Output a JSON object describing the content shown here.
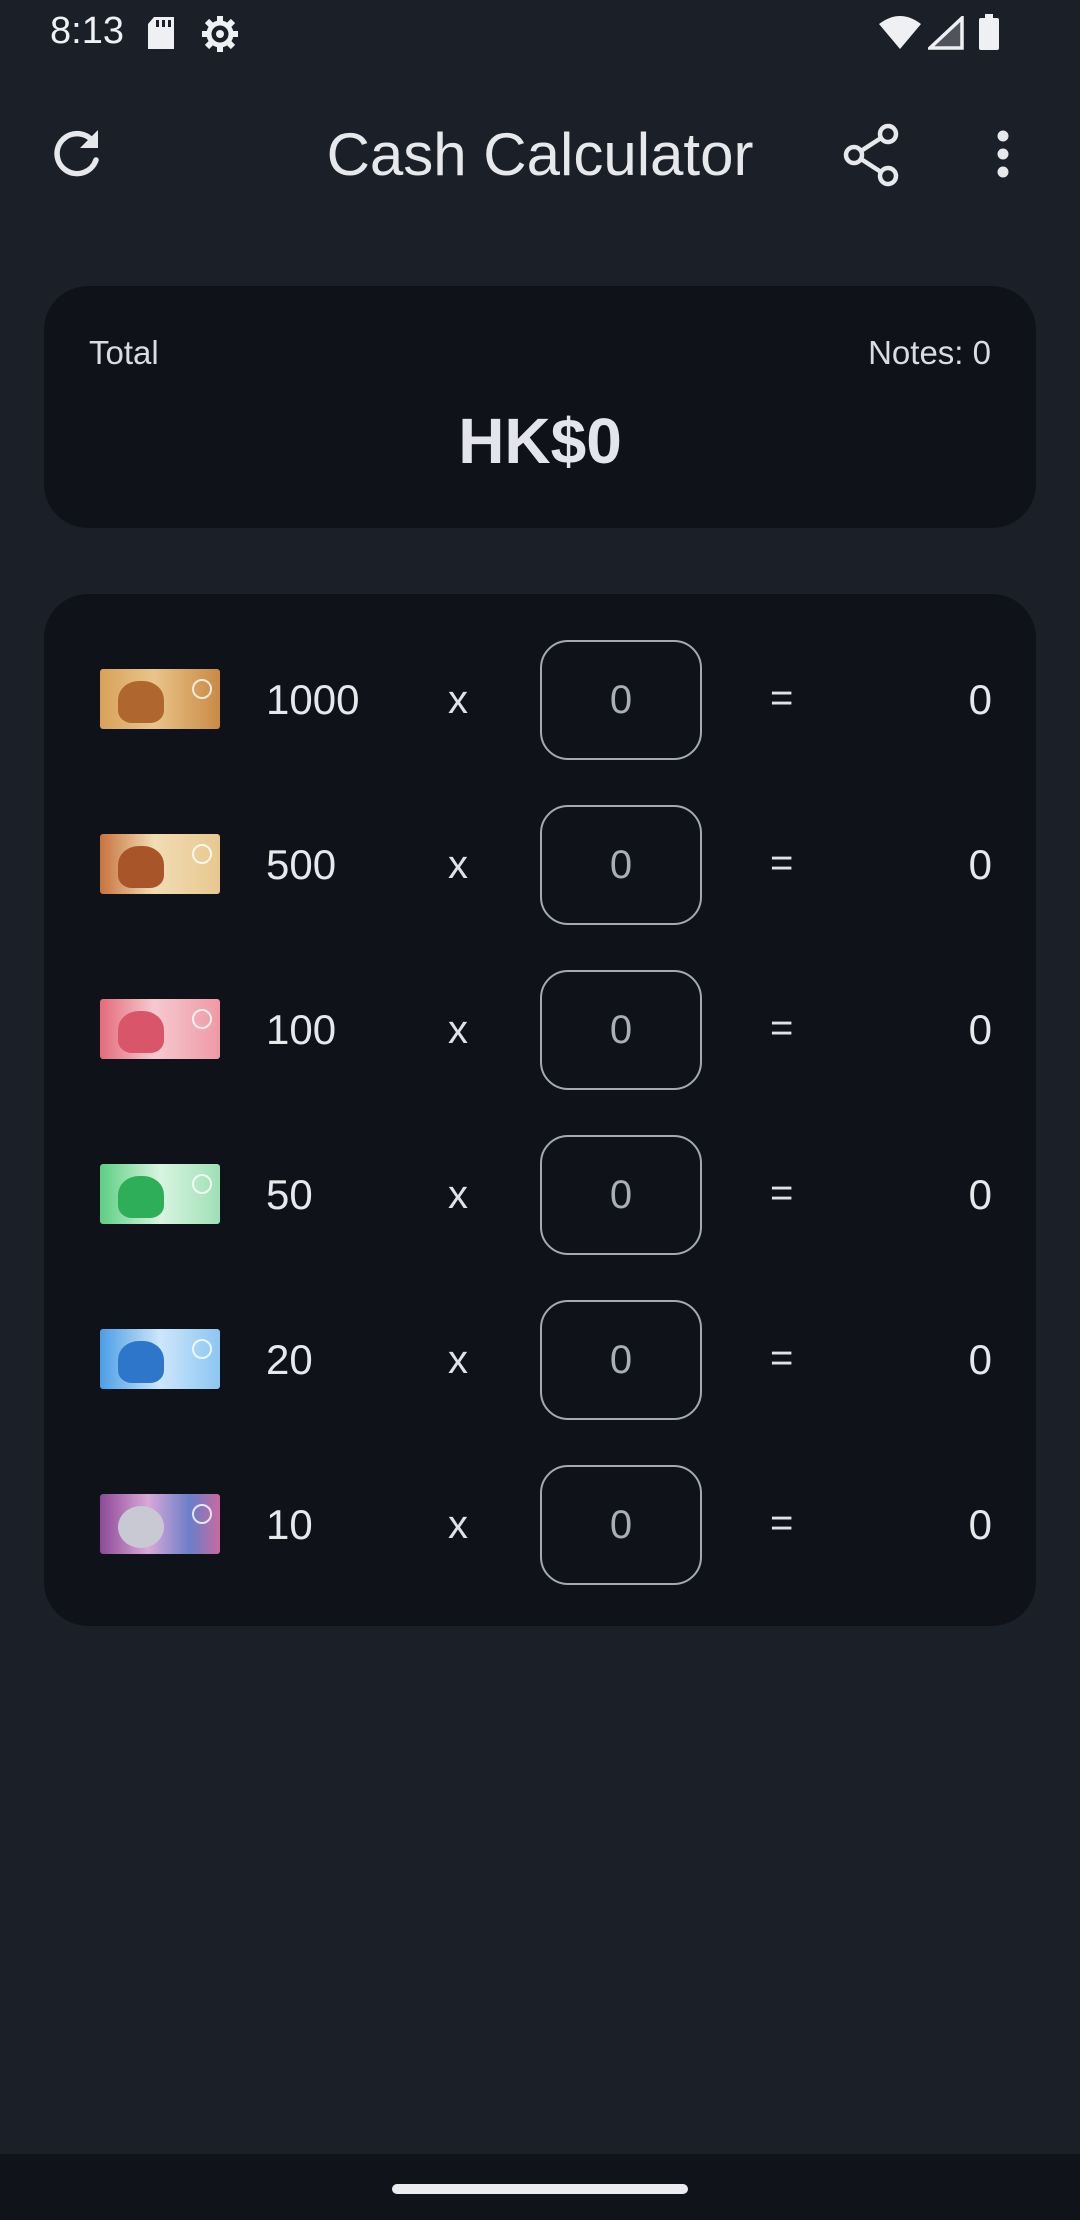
{
  "status_bar": {
    "time": "8:13",
    "icons": [
      "sd-card-icon",
      "settings-gear-icon",
      "wifi-icon",
      "cell-signal-icon",
      "battery-icon"
    ]
  },
  "app_bar": {
    "title": "Cash Calculator",
    "refresh_icon": "refresh-icon",
    "share_icon": "share-icon",
    "menu_icon": "more-vert-icon"
  },
  "summary": {
    "total_label": "Total",
    "notes_label": "Notes: 0",
    "total_value": "HK$0"
  },
  "denominations": [
    {
      "value": "1000",
      "times": "x",
      "quantity": "0",
      "equals": "=",
      "subtotal": "0",
      "note_color": "#c9944a"
    },
    {
      "value": "500",
      "times": "x",
      "quantity": "0",
      "equals": "=",
      "subtotal": "0",
      "note_color": "#c47e4d"
    },
    {
      "value": "100",
      "times": "x",
      "quantity": "0",
      "equals": "=",
      "subtotal": "0",
      "note_color": "#e57a86"
    },
    {
      "value": "50",
      "times": "x",
      "quantity": "0",
      "equals": "=",
      "subtotal": "0",
      "note_color": "#3cbf6a"
    },
    {
      "value": "20",
      "times": "x",
      "quantity": "0",
      "equals": "=",
      "subtotal": "0",
      "note_color": "#3a8fd9"
    },
    {
      "value": "10",
      "times": "x",
      "quantity": "0",
      "equals": "=",
      "subtotal": "0",
      "note_color": "#9a4f9c"
    }
  ],
  "colors": {
    "background": "#1b1f28",
    "card": "#0f1319",
    "input_border": "#a4a9b3"
  }
}
